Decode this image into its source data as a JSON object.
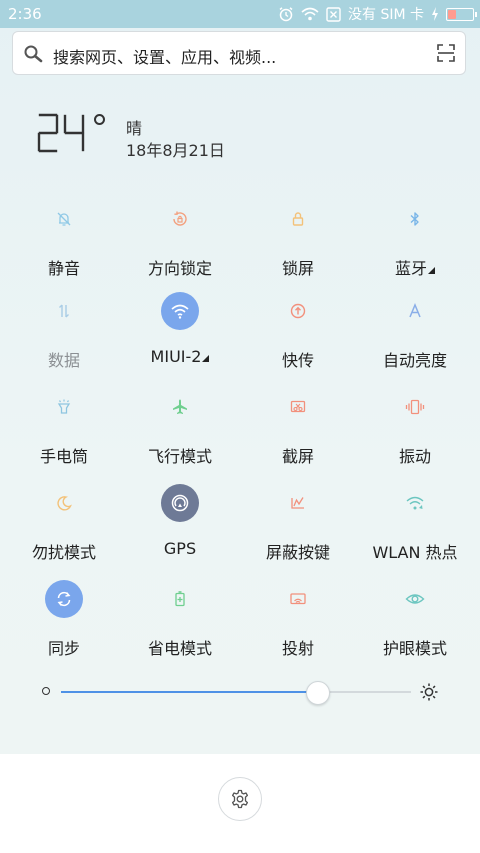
{
  "status_bar": {
    "time": "2:36",
    "carrier": "没有 SIM 卡",
    "icons": [
      "alarm-icon",
      "wifi-icon",
      "no-sim-icon",
      "charging-icon",
      "battery-icon"
    ]
  },
  "search": {
    "placeholder": "搜索网页、设置、应用、视频..."
  },
  "weather": {
    "temperature": "24",
    "condition": "晴",
    "date": "18年8月21日"
  },
  "toggles": [
    {
      "label": "静音",
      "icon": "bell-off-icon",
      "state": "off",
      "color": "#8fc9e6"
    },
    {
      "label": "方向锁定",
      "icon": "rotation-lock-icon",
      "state": "off",
      "color": "#f3a07e"
    },
    {
      "label": "锁屏",
      "icon": "lock-icon",
      "state": "off",
      "color": "#f3c27a"
    },
    {
      "label": "蓝牙",
      "icon": "bluetooth-icon",
      "state": "off",
      "color": "#7ab6e8",
      "has_menu": true
    },
    {
      "label": "数据",
      "icon": "data-icon",
      "state": "disabled",
      "color": "#a9cde6"
    },
    {
      "label": "MIUI-2",
      "icon": "wifi-icon",
      "state": "on",
      "color": "#7aa6ec",
      "has_menu": true
    },
    {
      "label": "快传",
      "icon": "transfer-icon",
      "state": "off",
      "color": "#f2907c"
    },
    {
      "label": "自动亮度",
      "icon": "auto-brightness-icon",
      "state": "off",
      "color": "#8aaee8"
    },
    {
      "label": "手电筒",
      "icon": "flashlight-icon",
      "state": "off",
      "color": "#8ec5e0"
    },
    {
      "label": "飞行模式",
      "icon": "airplane-icon",
      "state": "off",
      "color": "#6fcf8f"
    },
    {
      "label": "截屏",
      "icon": "screenshot-icon",
      "state": "off",
      "color": "#f2907c"
    },
    {
      "label": "振动",
      "icon": "vibrate-icon",
      "state": "off",
      "color": "#f2907c"
    },
    {
      "label": "勿扰模式",
      "icon": "moon-icon",
      "state": "off",
      "color": "#f3c27a"
    },
    {
      "label": "GPS",
      "icon": "gps-icon",
      "state": "on",
      "color": "#6e7a96"
    },
    {
      "label": "屏蔽按键",
      "icon": "block-keys-icon",
      "state": "off",
      "color": "#f2907c"
    },
    {
      "label": "WLAN 热点",
      "icon": "hotspot-icon",
      "state": "off",
      "color": "#6cc6c0"
    },
    {
      "label": "同步",
      "icon": "sync-icon",
      "state": "on",
      "color": "#7aa6ec"
    },
    {
      "label": "省电模式",
      "icon": "battery-saver-icon",
      "state": "off",
      "color": "#6fcf8f"
    },
    {
      "label": "投射",
      "icon": "cast-icon",
      "state": "off",
      "color": "#f2907c"
    },
    {
      "label": "护眼模式",
      "icon": "eye-icon",
      "state": "off",
      "color": "#6cc6c0"
    }
  ],
  "brightness": {
    "level": 0.73
  },
  "settings_icon": "gear-icon"
}
